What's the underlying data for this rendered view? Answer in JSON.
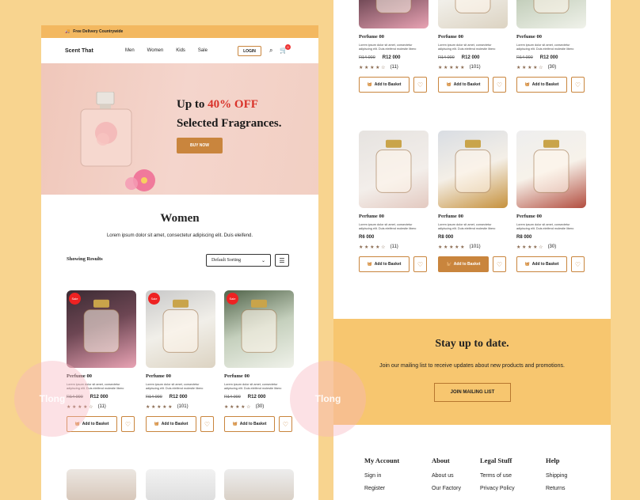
{
  "topbar": {
    "text": "Free Delivery Countrywide"
  },
  "nav": {
    "logo": "Scent That",
    "items": [
      "Men",
      "Women",
      "Kids",
      "Sale"
    ],
    "login": "LOGIN",
    "cart_count": "0"
  },
  "hero": {
    "line1_prefix": "Up to ",
    "line1_accent": "40% OFF",
    "line2": "Selected Fragrances.",
    "button": "BUY NOW"
  },
  "section": {
    "title": "Women",
    "subtitle": "Lorem ipsum dolor sit amet, consectetur adipiscing elit. Duis eleifend.",
    "showing": "Showing Results",
    "sort": "Default Sorting"
  },
  "products_left": [
    {
      "sale": "Sale",
      "name": "Perfume 00",
      "desc": "Lorem ipsum dolor sit amet, consectetur adipiscing elit. Duis eleifend molestie libero",
      "old": "R14 000",
      "price": "R12 000",
      "stars": "★ ★ ★ ★ ☆",
      "count": "(11)",
      "basket": "Add to Basket"
    },
    {
      "sale": "Sale",
      "name": "Perfume 00",
      "desc": "Lorem ipsum dolor sit amet, consectetur adipiscing elit. Duis eleifend molestie libero",
      "old": "R14 000",
      "price": "R12 000",
      "stars": "★ ★ ★ ★ ★",
      "count": "(101)",
      "basket": "Add to Basket"
    },
    {
      "sale": "Sale",
      "name": "Perfume 00",
      "desc": "Lorem ipsum dolor sit amet, consectetur adipiscing elit. Duis eleifend molestie libero",
      "old": "R14 000",
      "price": "R12 000",
      "stars": "★ ★ ★ ★ ☆",
      "count": "(30)",
      "basket": "Add to Basket"
    }
  ],
  "products_right_top": [
    {
      "name": "Perfume 00",
      "desc": "Lorem ipsum dolor sit amet, consectetur adipiscing elit. Duis eleifend molestie libero",
      "old": "R14 000",
      "price": "R12 000",
      "stars": "★ ★ ★ ★ ☆",
      "count": "(11)",
      "basket": "Add to Basket"
    },
    {
      "name": "Perfume 00",
      "desc": "Lorem ipsum dolor sit amet, consectetur adipiscing elit. Duis eleifend molestie libero",
      "old": "R14 000",
      "price": "R12 000",
      "stars": "★ ★ ★ ★ ★",
      "count": "(101)",
      "basket": "Add to Basket"
    },
    {
      "name": "Perfume 00",
      "desc": "Lorem ipsum dolor sit amet, consectetur adipiscing elit. Duis eleifend molestie libero",
      "old": "R14 000",
      "price": "R12 000",
      "stars": "★ ★ ★ ★ ☆",
      "count": "(30)",
      "basket": "Add to Basket"
    }
  ],
  "products_right_bottom": [
    {
      "name": "Perfume 00",
      "desc": "Lorem ipsum dolor sit amet, consectetur adipiscing elit. Duis eleifend molestie libero",
      "price": "R6 000",
      "stars": "★ ★ ★ ★ ☆",
      "count": "(11)",
      "basket": "Add to Basket"
    },
    {
      "name": "Perfume 00",
      "desc": "Lorem ipsum dolor sit amet, consectetur adipiscing elit. Duis eleifend molestie libero",
      "price": "R8 000",
      "stars": "★ ★ ★ ★ ★",
      "count": "(101)",
      "basket": "Add to Basket"
    },
    {
      "name": "Perfume 00",
      "desc": "Lorem ipsum dolor sit amet, consectetur adipiscing elit. Duis eleifend molestie libero",
      "price": "R8 000",
      "stars": "★ ★ ★ ★ ☆",
      "count": "(30)",
      "basket": "Add to Basket"
    }
  ],
  "newsletter": {
    "title": "Stay up to date.",
    "subtitle": "Join our mailing list to receive updates about new products and promotions.",
    "button": "JOIN MAILING LIST"
  },
  "footer": {
    "cols": [
      {
        "title": "My Account",
        "links": [
          "Sign in",
          "Register"
        ]
      },
      {
        "title": "About",
        "links": [
          "About us",
          "Our Factory"
        ]
      },
      {
        "title": "Legal Stuff",
        "links": [
          "Terms of use",
          "Privacy Policy"
        ]
      },
      {
        "title": "Help",
        "links": [
          "Shipping",
          "Returns"
        ]
      }
    ]
  },
  "colors": {
    "accent": "#c9853d",
    "background": "#f8d48f",
    "sale": "#e22222"
  }
}
